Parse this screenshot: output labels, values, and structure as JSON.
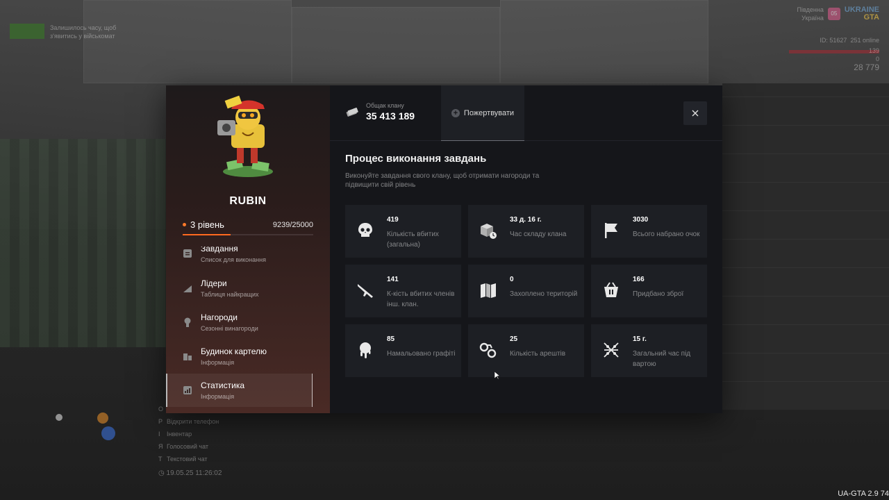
{
  "hud": {
    "notice_line1": "Залишилось часу, щоб",
    "notice_line2": "з'явитись у військомат",
    "server_line1": "Південна",
    "server_line2": "Україна",
    "server_badge": "05",
    "logo_line1": "UKRAINE",
    "logo_line2": "GTA",
    "player_id": "ID: 51627",
    "online": "251 online",
    "health": "139",
    "armor": "0",
    "money": "28 779",
    "help": [
      {
        "key": "O",
        "text": ""
      },
      {
        "key": "P",
        "text": "Відкрити телефон"
      },
      {
        "key": "I",
        "text": "Інвентар"
      },
      {
        "key": "Я",
        "text": "Голосовий чат"
      },
      {
        "key": "T",
        "text": "Текстовий чат"
      }
    ],
    "datetime": "19.05.25 11:26:02",
    "version": "UA-GTA 2.9   74"
  },
  "clan": {
    "name": "RUBIN",
    "level": "3 рівень",
    "xp": "9239/25000",
    "xp_fraction": 0.3696
  },
  "menu": [
    {
      "title": "Завдання",
      "subtitle": "Список для виконання",
      "icon": "task-icon"
    },
    {
      "title": "Лідери",
      "subtitle": "Таблиця найкращих",
      "icon": "chart-icon"
    },
    {
      "title": "Нагороди",
      "subtitle": "Сезонні винагороди",
      "icon": "medal-icon"
    },
    {
      "title": "Будинок картелю",
      "subtitle": "Інформація",
      "icon": "house-icon"
    },
    {
      "title": "Статистика",
      "subtitle": "Інформація",
      "icon": "stats-icon"
    }
  ],
  "bank": {
    "label": "Общак клану",
    "value": "35 413 189"
  },
  "donate_label": "Пожертвувати",
  "section": {
    "title": "Процес виконання завдань",
    "subtitle": "Виконуйте завдання свого клану, щоб отримати нагороди та підвищити свій рівень"
  },
  "stats": [
    {
      "value": "419",
      "label": "Кількість вбитих (загальна)",
      "icon": "skull-icon"
    },
    {
      "value": "33 д. 16 г.",
      "label": "Час складу клана",
      "icon": "box-clock-icon"
    },
    {
      "value": "3030",
      "label": "Всього набрано очок",
      "icon": "flag-icon"
    },
    {
      "value": "141",
      "label": "К-кість вбитих членів інш. клан.",
      "icon": "rifle-icon"
    },
    {
      "value": "0",
      "label": "Захоплено територій",
      "icon": "map-icon"
    },
    {
      "value": "166",
      "label": "Придбано зброї",
      "icon": "basket-icon"
    },
    {
      "value": "85",
      "label": "Намальовано графіті",
      "icon": "spray-icon"
    },
    {
      "value": "25",
      "label": "Кількість арештів",
      "icon": "handcuffs-icon"
    },
    {
      "value": "15 г.",
      "label": "Загальний час під вартою",
      "icon": "barbed-wire-icon"
    }
  ],
  "colors": {
    "accent": "#ff6a1f",
    "panel_right": "#15161a",
    "card": "#1d1f24"
  }
}
